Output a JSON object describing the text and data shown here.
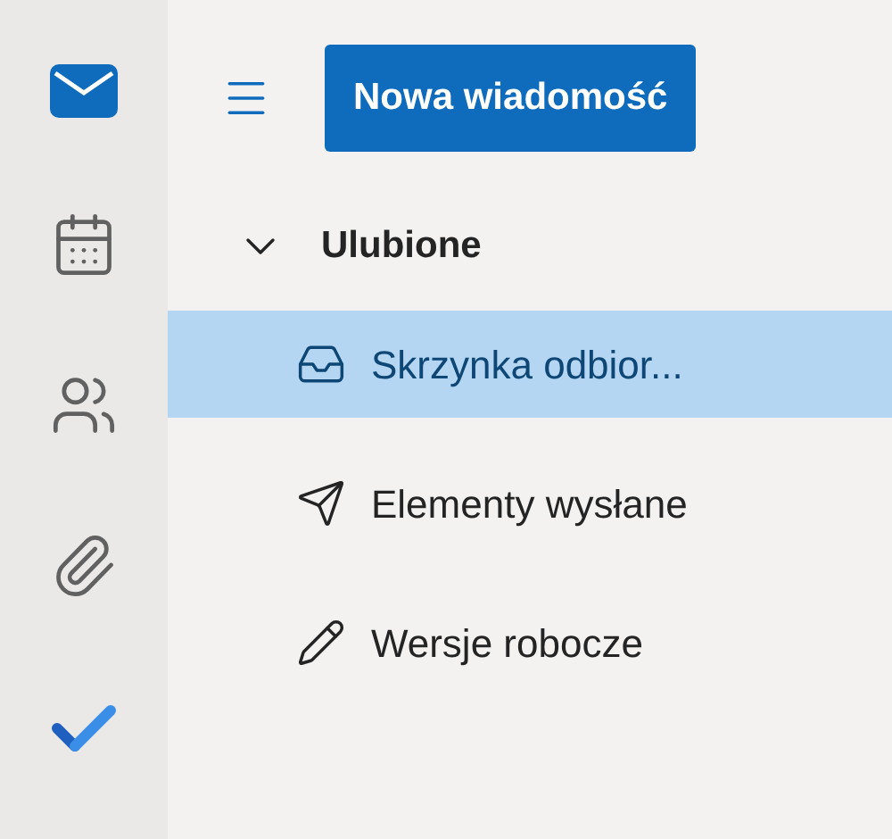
{
  "rail": [
    {
      "kind": "mail",
      "selected": true
    },
    {
      "kind": "calendar",
      "selected": false
    },
    {
      "kind": "people",
      "selected": false
    },
    {
      "kind": "attach",
      "selected": false
    },
    {
      "kind": "todo",
      "selected": false
    }
  ],
  "new_button": "Nowa wiadomość",
  "favorites": {
    "label": "Ulubione",
    "expanded": true,
    "items": [
      {
        "kind": "inbox",
        "label": "Skrzynka odbior...",
        "selected": true
      },
      {
        "kind": "sent",
        "label": "Elementy wysłane",
        "selected": false
      },
      {
        "kind": "drafts",
        "label": "Wersje robocze",
        "selected": false
      }
    ]
  }
}
